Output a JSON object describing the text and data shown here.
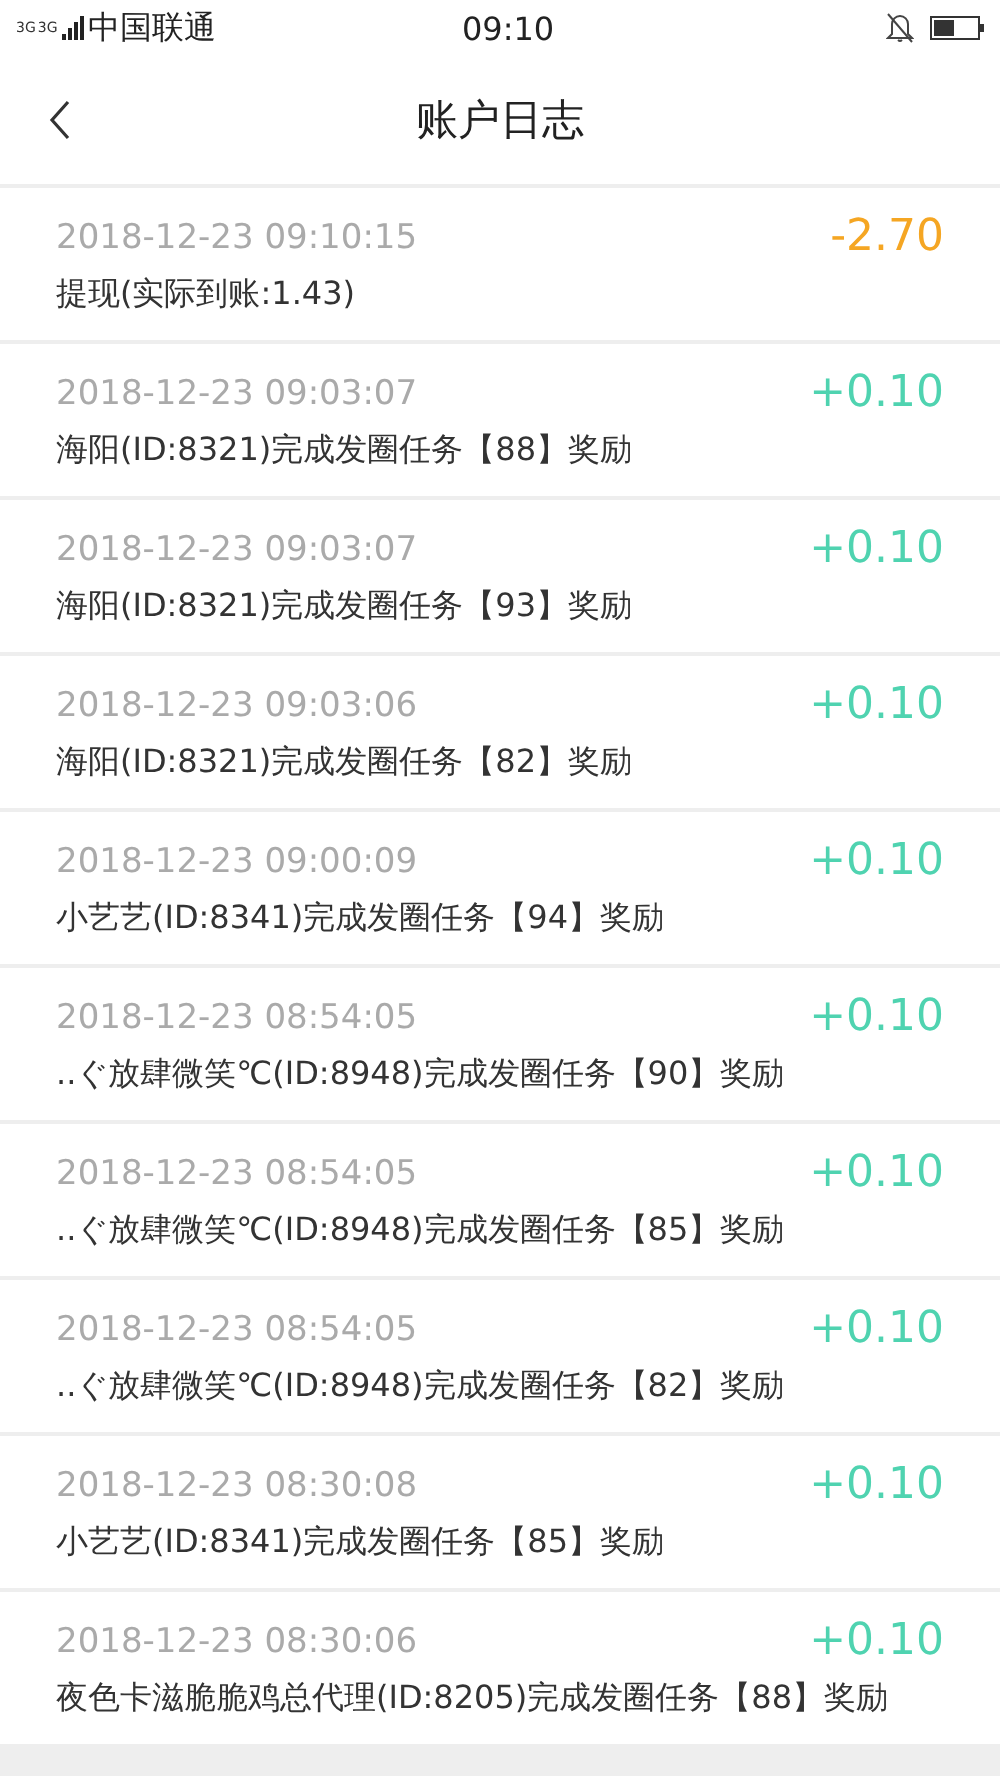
{
  "status_bar": {
    "network_labels": [
      "3G",
      "3G"
    ],
    "carrier": "中国联通",
    "time": "09:10"
  },
  "header": {
    "title": "账户日志"
  },
  "entries": [
    {
      "time": "2018-12-23 09:10:15",
      "amount": "-2.70",
      "kind": "debit",
      "description": "提现(实际到账:1.43)"
    },
    {
      "time": "2018-12-23 09:03:07",
      "amount": "+0.10",
      "kind": "credit",
      "description": "海阳(ID:8321)完成发圈任务【88】奖励"
    },
    {
      "time": "2018-12-23 09:03:07",
      "amount": "+0.10",
      "kind": "credit",
      "description": "海阳(ID:8321)完成发圈任务【93】奖励"
    },
    {
      "time": "2018-12-23 09:03:06",
      "amount": "+0.10",
      "kind": "credit",
      "description": "海阳(ID:8321)完成发圈任务【82】奖励"
    },
    {
      "time": "2018-12-23 09:00:09",
      "amount": "+0.10",
      "kind": "credit",
      "description": "小艺艺(ID:8341)完成发圈任务【94】奖励"
    },
    {
      "time": "2018-12-23 08:54:05",
      "amount": "+0.10",
      "kind": "credit",
      "description": "..ぐ放肆微笑℃(ID:8948)完成发圈任务【90】奖励"
    },
    {
      "time": "2018-12-23 08:54:05",
      "amount": "+0.10",
      "kind": "credit",
      "description": "..ぐ放肆微笑℃(ID:8948)完成发圈任务【85】奖励"
    },
    {
      "time": "2018-12-23 08:54:05",
      "amount": "+0.10",
      "kind": "credit",
      "description": "..ぐ放肆微笑℃(ID:8948)完成发圈任务【82】奖励"
    },
    {
      "time": "2018-12-23 08:30:08",
      "amount": "+0.10",
      "kind": "credit",
      "description": "小艺艺(ID:8341)完成发圈任务【85】奖励"
    },
    {
      "time": "2018-12-23 08:30:06",
      "amount": "+0.10",
      "kind": "credit",
      "description": "夜色卡滋脆脆鸡总代理(ID:8205)完成发圈任务【88】奖励"
    }
  ]
}
